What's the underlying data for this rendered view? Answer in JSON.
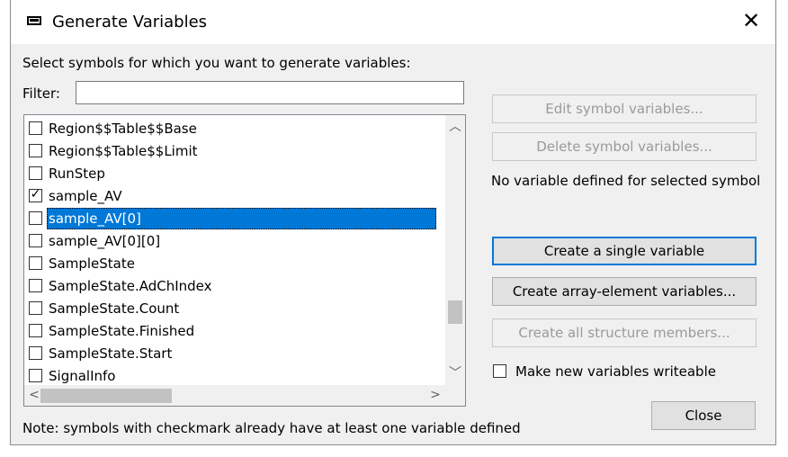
{
  "window": {
    "title": "Generate Variables",
    "close_glyph": "✕"
  },
  "instructions": "Select symbols for which you want to generate variables:",
  "filter": {
    "label": "Filter:",
    "value": ""
  },
  "symbols": [
    {
      "label": "Region$$Table$$Base",
      "checked": false,
      "selected": false
    },
    {
      "label": "Region$$Table$$Limit",
      "checked": false,
      "selected": false
    },
    {
      "label": "RunStep",
      "checked": false,
      "selected": false
    },
    {
      "label": "sample_AV",
      "checked": true,
      "selected": false
    },
    {
      "label": "sample_AV[0]",
      "checked": false,
      "selected": true
    },
    {
      "label": "sample_AV[0][0]",
      "checked": false,
      "selected": false
    },
    {
      "label": "SampleState",
      "checked": false,
      "selected": false
    },
    {
      "label": "SampleState.AdChIndex",
      "checked": false,
      "selected": false
    },
    {
      "label": "SampleState.Count",
      "checked": false,
      "selected": false
    },
    {
      "label": "SampleState.Finished",
      "checked": false,
      "selected": false
    },
    {
      "label": "SampleState.Start",
      "checked": false,
      "selected": false
    },
    {
      "label": "SignalInfo",
      "checked": false,
      "selected": false
    }
  ],
  "checkmark_glyph": "✓",
  "scroll": {
    "up": "︿",
    "down": "﹀",
    "left": "<",
    "right": ">"
  },
  "buttons": {
    "edit": "Edit symbol variables...",
    "delete": "Delete symbol variables...",
    "create_single": "Create a single variable",
    "create_array": "Create array-element variables...",
    "create_struct": "Create all structure members...",
    "close": "Close"
  },
  "status": "No variable defined for selected symbol",
  "writeable_label": "Make new variables writeable",
  "note": "Note: symbols with checkmark already have at least one variable defined",
  "colors": {
    "selection": "#0078d7",
    "dialog_bg": "#f0f0f0"
  }
}
